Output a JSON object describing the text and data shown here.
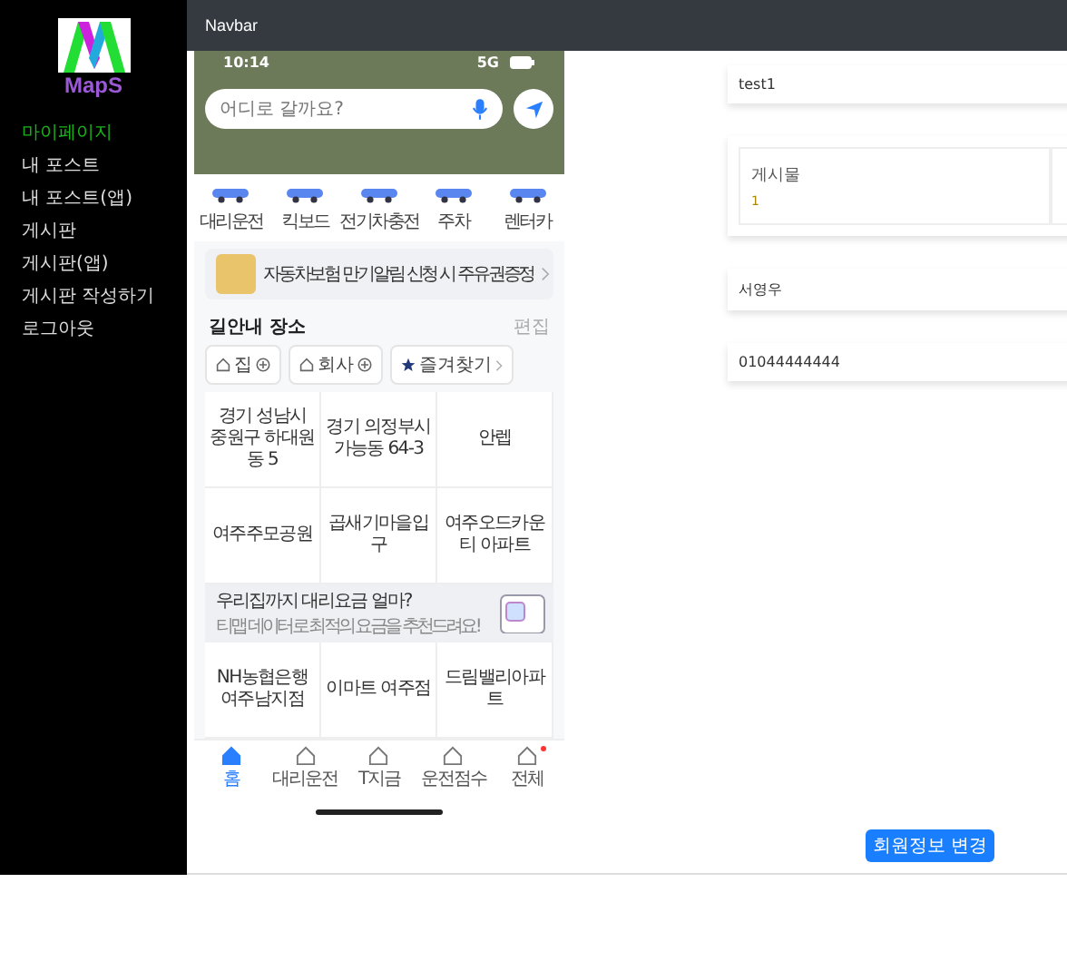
{
  "sidebar": {
    "logo": "MapS",
    "items": [
      {
        "label": "마이페이지",
        "selected": true
      },
      {
        "label": "내 포스트",
        "selected": false
      },
      {
        "label": "내 포스트(앱)",
        "selected": false
      },
      {
        "label": "게시판",
        "selected": false
      },
      {
        "label": "게시판(앱)",
        "selected": false
      },
      {
        "label": "게시판 작성하기",
        "selected": false
      },
      {
        "label": "로그아웃",
        "selected": false
      }
    ]
  },
  "navbar": {
    "title": "Navbar"
  },
  "phone": {
    "status_time": "10:14",
    "status_network": "5G",
    "search": {
      "placeholder": "어디로 갈까요?"
    },
    "shortcuts": [
      {
        "label": "대리운전"
      },
      {
        "label": "킥보드"
      },
      {
        "label": "전기차충전"
      },
      {
        "label": "주차"
      },
      {
        "label": "렌터카"
      }
    ],
    "banner": {
      "text": "자동차보험 만기알림 신청 시 주유권증정"
    },
    "places": {
      "title": "길안내 장소",
      "edit": "편집",
      "chips": [
        {
          "label": "집",
          "kind": "add"
        },
        {
          "label": "회사",
          "kind": "add"
        },
        {
          "label": "즐겨찾기",
          "kind": "more"
        }
      ],
      "cells": [
        "경기 성남시 중원구 하대원동 5",
        "경기 의정부시 가능동 64-3",
        "안렙",
        "여주주모공원",
        "곱새기마을입구",
        "여주오드카운티 아파트"
      ],
      "promo": {
        "title": "우리집까지 대리요금 얼마?",
        "subtitle": "티맵 데이터로 최적의 요금을 추천드려요!"
      },
      "more_cells": [
        "NH농협은행 여주남지점",
        "이마트 여주점",
        "드림밸리아파트"
      ]
    },
    "bottom_nav": [
      {
        "label": "홈",
        "selected": true,
        "badge": false
      },
      {
        "label": "대리운전",
        "selected": false,
        "badge": false
      },
      {
        "label": "T지금",
        "selected": false,
        "badge": false
      },
      {
        "label": "운전점수",
        "selected": false,
        "badge": false
      },
      {
        "label": "전체",
        "selected": false,
        "badge": true
      }
    ]
  },
  "profile": {
    "username": "test1",
    "stats": [
      {
        "label": "게시물",
        "value": "1"
      }
    ],
    "name": "서영우",
    "phone": "01044444444",
    "button": "회원정보 변경"
  }
}
